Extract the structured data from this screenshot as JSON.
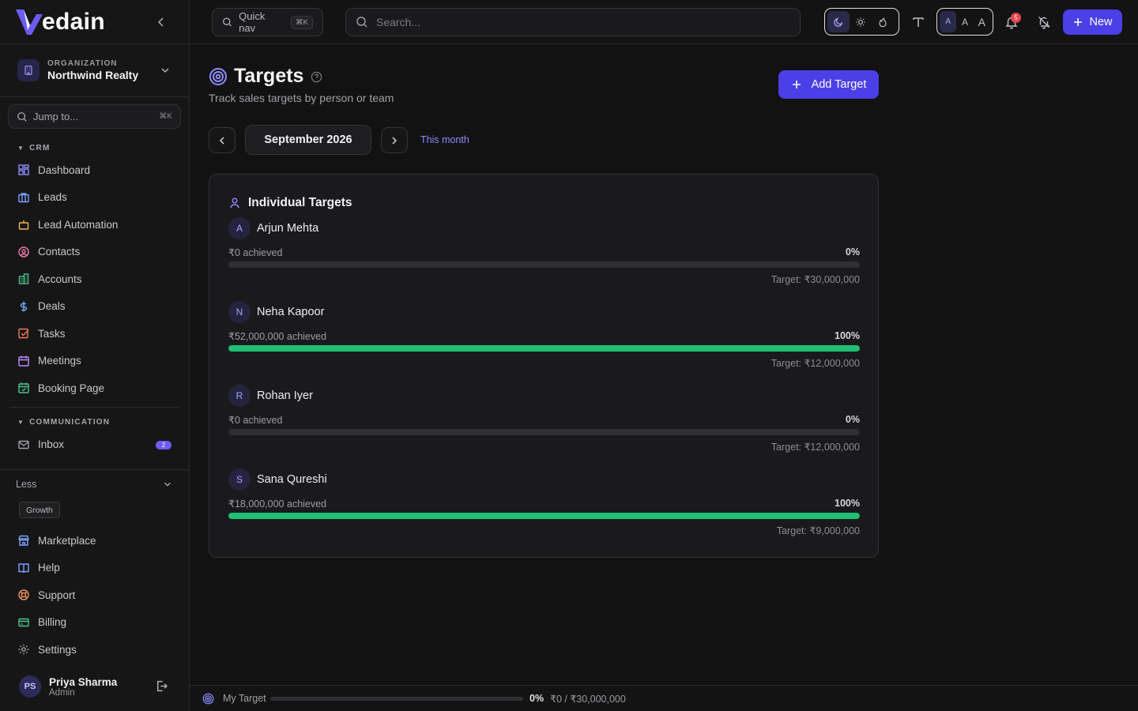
{
  "brand": {
    "logo_letter": "V",
    "logo_text": "edain",
    "accent": "#4b3fe8",
    "success": "#1fbf74"
  },
  "org": {
    "label": "ORGANIZATION",
    "name": "Northwind Realty"
  },
  "jump": {
    "placeholder": "Jump to...",
    "shortcut": "⌘K"
  },
  "sidebar": {
    "crm_label": "CRM",
    "crm_items": [
      {
        "label": "Dashboard",
        "icon": "dashboard-icon"
      },
      {
        "label": "Leads",
        "icon": "briefcase-icon"
      },
      {
        "label": "Lead Automation",
        "icon": "bot-icon"
      },
      {
        "label": "Contacts",
        "icon": "contact-icon"
      },
      {
        "label": "Accounts",
        "icon": "building-icon"
      },
      {
        "label": "Deals",
        "icon": "dollar-icon"
      },
      {
        "label": "Tasks",
        "icon": "check-square-icon"
      },
      {
        "label": "Meetings",
        "icon": "calendar-icon"
      },
      {
        "label": "Booking Page",
        "icon": "calendar-check-icon"
      }
    ],
    "comm_label": "COMMUNICATION",
    "comm_items": [
      {
        "label": "Inbox",
        "icon": "mail-icon",
        "badge": "2"
      }
    ],
    "less_label": "Less",
    "growth_label": "Growth",
    "bottom_items": [
      {
        "label": "Marketplace",
        "icon": "store-icon"
      },
      {
        "label": "Help",
        "icon": "book-icon"
      },
      {
        "label": "Support",
        "icon": "life-buoy-icon"
      },
      {
        "label": "Billing",
        "icon": "credit-card-icon"
      },
      {
        "label": "Settings",
        "icon": "gear-icon"
      }
    ]
  },
  "user": {
    "initials": "PS",
    "name": "Priya Sharma",
    "role": "Admin"
  },
  "topbar": {
    "quicknav_label": "Quick nav",
    "quicknav_shortcut": "⌘K",
    "search_placeholder": "Search...",
    "font_sizes": [
      "A",
      "A",
      "A"
    ],
    "notification_count": "5",
    "new_label": "New"
  },
  "page": {
    "title": "Targets",
    "subtitle": "Track sales targets by person or team",
    "add_label": "Add Target",
    "month": "September 2026",
    "this_month_label": "This month"
  },
  "card": {
    "title": "Individual Targets",
    "people": [
      {
        "initial": "A",
        "name": "Arjun Mehta",
        "achieved": "₹0 achieved",
        "pct_label": "0%",
        "progress": 0,
        "target": "Target: ₹30,000,000"
      },
      {
        "initial": "N",
        "name": "Neha Kapoor",
        "achieved": "₹52,000,000 achieved",
        "pct_label": "100%",
        "progress": 1.0,
        "target": "Target: ₹12,000,000"
      },
      {
        "initial": "R",
        "name": "Rohan Iyer",
        "achieved": "₹0 achieved",
        "pct_label": "0%",
        "progress": 0,
        "target": "Target: ₹12,000,000"
      },
      {
        "initial": "S",
        "name": "Sana Qureshi",
        "achieved": "₹18,000,000 achieved",
        "pct_label": "100%",
        "progress": 1.0,
        "target": "Target: ₹9,000,000"
      }
    ]
  },
  "my_target": {
    "label": "My Target",
    "pct_label": "0%",
    "progress": 0,
    "amount": "₹0 / ₹30,000,000"
  }
}
